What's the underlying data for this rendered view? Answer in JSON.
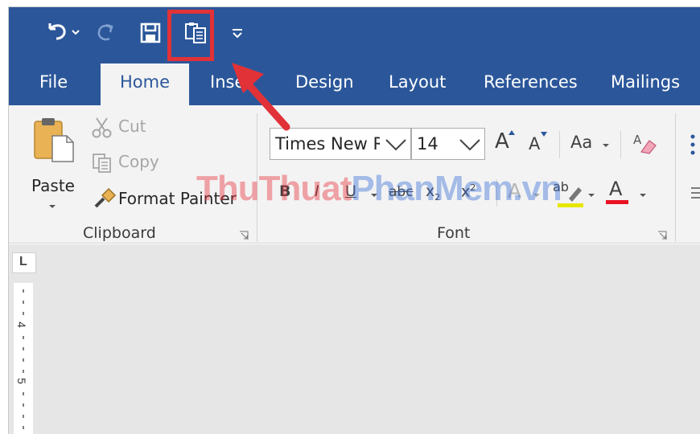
{
  "qat": {
    "undo_icon": "undo-icon",
    "redo_icon": "redo-icon",
    "save_icon": "save-icon",
    "paste_special_icon": "paste-icon",
    "customize_icon": "customize-qat-icon"
  },
  "tabs": [
    "File",
    "Home",
    "Inse",
    "Design",
    "Layout",
    "References",
    "Mailings"
  ],
  "clipboard": {
    "paste": "Paste",
    "cut": "Cut",
    "copy": "Copy",
    "format_painter": "Format Painter",
    "group_label": "Clipboard"
  },
  "font": {
    "font_name": "Times New R",
    "font_size": "14",
    "grow": "A",
    "shrink": "A",
    "change_case": "Aa",
    "bold": "B",
    "italic": "I",
    "underline": "U",
    "strike": "abc",
    "subscript": "x",
    "subscript_mark": "2",
    "superscript": "x",
    "superscript_mark": "2",
    "text_effects": "A",
    "highlight": "ab",
    "font_color": "A",
    "group_label": "Font"
  },
  "ruler": {
    "tab_marker": "L",
    "mark_4": "4",
    "mark_5": "5"
  },
  "watermark": {
    "part1": "ThuThuat",
    "part2": "PhanMem",
    "part3": ".vn"
  },
  "colors": {
    "accent": "#2b579a",
    "highlight_red": "#e13238",
    "font_color_bar": "#e81123",
    "highlight_bar": "#ffff00"
  }
}
